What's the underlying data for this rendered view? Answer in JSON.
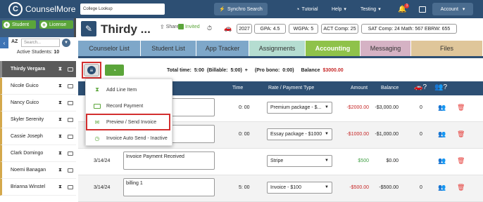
{
  "topbar": {
    "brand": "CounselMore",
    "logo_letter": "C",
    "search_value": "College Lookup",
    "synchro_label": "Synchro Search",
    "tutorial_label": "Tutorial",
    "help_label": "Help",
    "testing_label": "Testing",
    "bell_count": "1",
    "account_label": "Account"
  },
  "sidebar": {
    "add_student_label": "Student",
    "add_license_label": "License",
    "sort_label": "AZ",
    "search_placeholder": "Search...",
    "active_label": "Active Students:",
    "active_count": "10",
    "students": [
      "Thirdy Vergara",
      "Nicole Guico",
      "Nancy Guico",
      "Skyler Serenity",
      "Cassie Joseph",
      "Clark Domingo",
      "Noemi Banagan",
      "Brianna Winstel"
    ]
  },
  "header": {
    "student_name": "Thirdy ...",
    "share_label": "Share",
    "invited_label": "Invited",
    "pills": [
      "2027",
      "GPA: 4.5",
      "WGPA: 5",
      "ACT Comp: 25",
      "SAT Comp: 24 Math: 567 EBRW: 655"
    ]
  },
  "tabs": [
    {
      "label": "Counselor List",
      "color": "#7ea7c9"
    },
    {
      "label": "Student List",
      "color": "#7ea7c9"
    },
    {
      "label": "App Tracker",
      "color": "#7ea7c9"
    },
    {
      "label": "Assignments",
      "color": "#b5ddd1"
    },
    {
      "label": "Accounting",
      "color": "#8fc24a"
    },
    {
      "label": "Messaging",
      "color": "#d5b2c4"
    },
    {
      "label": "Files",
      "color": "#dfc69a"
    }
  ],
  "toolbar": {
    "total_time_label": "Total time:",
    "total_time_value": "5:00",
    "billable_label": "(Billable:",
    "billable_value": "5:00)",
    "plus": "+",
    "pro_bono_label": "(Pro bono:",
    "pro_bono_value": "0:00)",
    "balance_label": "Balance",
    "balance_value": "$3000.00"
  },
  "table": {
    "headers": {
      "time": "Time",
      "rate": "Rate / Payment Type",
      "amount": "Amount",
      "balance": "Balance"
    },
    "rows": [
      {
        "date": "",
        "note": "",
        "time": "0: 00",
        "rate": "Premium package - $...",
        "amount": "-$2000.00",
        "balance": "-$3,000.00",
        "count": "0",
        "amount_color": "red"
      },
      {
        "date": "",
        "note": "",
        "time": "0: 00",
        "rate": "Essay package - $1000",
        "amount": "-$1000.00",
        "balance": "-$1,000.00",
        "count": "0",
        "amount_color": "red"
      },
      {
        "date": "3/14/24",
        "note": "Invoice Payment Received",
        "time": "",
        "rate": "Stripe",
        "amount": "$500",
        "balance": "$0.00",
        "count": "",
        "amount_color": "green"
      },
      {
        "date": "3/14/24",
        "note": "billing 1",
        "time": "5: 00",
        "rate": "Invoice - $100",
        "amount": "-$500.00",
        "balance": "-$500.00",
        "count": "0",
        "amount_color": "red"
      }
    ]
  },
  "dropdown": {
    "items": [
      "Add Line Item",
      "Record Payment",
      "Preview / Send Invoice",
      "Invoice Auto Send - Inactive"
    ]
  },
  "colors": {
    "brand": "#2d4f73",
    "accent_green": "#5ba53a",
    "highlight_red": "#d32f2f"
  }
}
